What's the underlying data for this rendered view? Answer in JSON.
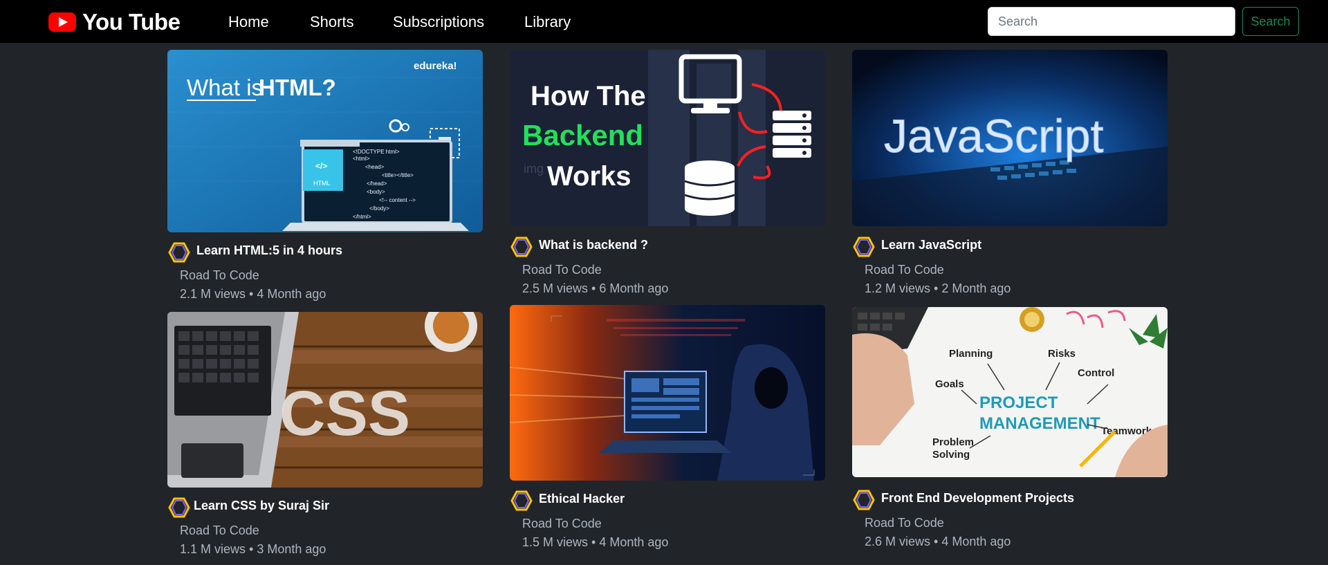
{
  "brand": {
    "name": "You Tube"
  },
  "nav": {
    "home": "Home",
    "shorts": "Shorts",
    "subscriptions": "Subscriptions",
    "library": "Library"
  },
  "search": {
    "placeholder": "Search",
    "button": "Search"
  },
  "videos": [
    {
      "title": "Learn HTML:5 in 4 hours",
      "channel": "Road To Code",
      "stats": "2.1 M views • 4 Month ago",
      "thumbnail": {
        "heading_plain": "What is",
        "heading_bold": "HTML?",
        "brand": "edureka!",
        "code": [
          "<!DOCTYPE html>",
          "<html>",
          "<head>",
          "<title></title>",
          "</head>",
          "<body>",
          "<!-- content -->",
          "</body>",
          "</html>"
        ],
        "file_label": "HTML"
      }
    },
    {
      "title": "What is backend ?",
      "channel": "Road To Code",
      "stats": "2.5 M views • 6 Month ago",
      "thumbnail": {
        "line1": "How The",
        "line2": "Backend",
        "line3": "Works",
        "watermark": "img"
      }
    },
    {
      "title": "Learn JavaScript",
      "channel": "Road To Code",
      "stats": "1.2 M views • 2 Month ago",
      "thumbnail": {
        "text": "JavaScript"
      }
    },
    {
      "title": "Learn CSS by Suraj Sir",
      "channel": "Road To Code",
      "stats": "1.1 M views • 3 Month ago",
      "thumbnail": {
        "text": "CSS"
      }
    },
    {
      "title": "Ethical Hacker",
      "channel": "Road To Code",
      "stats": "1.5 M views • 4 Month ago",
      "thumbnail": {}
    },
    {
      "title": "Front End Development Projects",
      "channel": "Road To Code",
      "stats": "2.6 M views • 4 Month ago",
      "thumbnail": {
        "line1": "PROJECT",
        "line2": "MANAGEMENT",
        "labels": [
          "Planning",
          "Risks",
          "Goals",
          "Control",
          "Teamwork",
          "Problem",
          "Solving"
        ]
      }
    }
  ],
  "colors": {
    "page_bg": "#212529",
    "navbar_bg": "#000000",
    "brand_red": "#ff0000",
    "search_green": "#198754",
    "muted_text": "#adb5bd"
  }
}
